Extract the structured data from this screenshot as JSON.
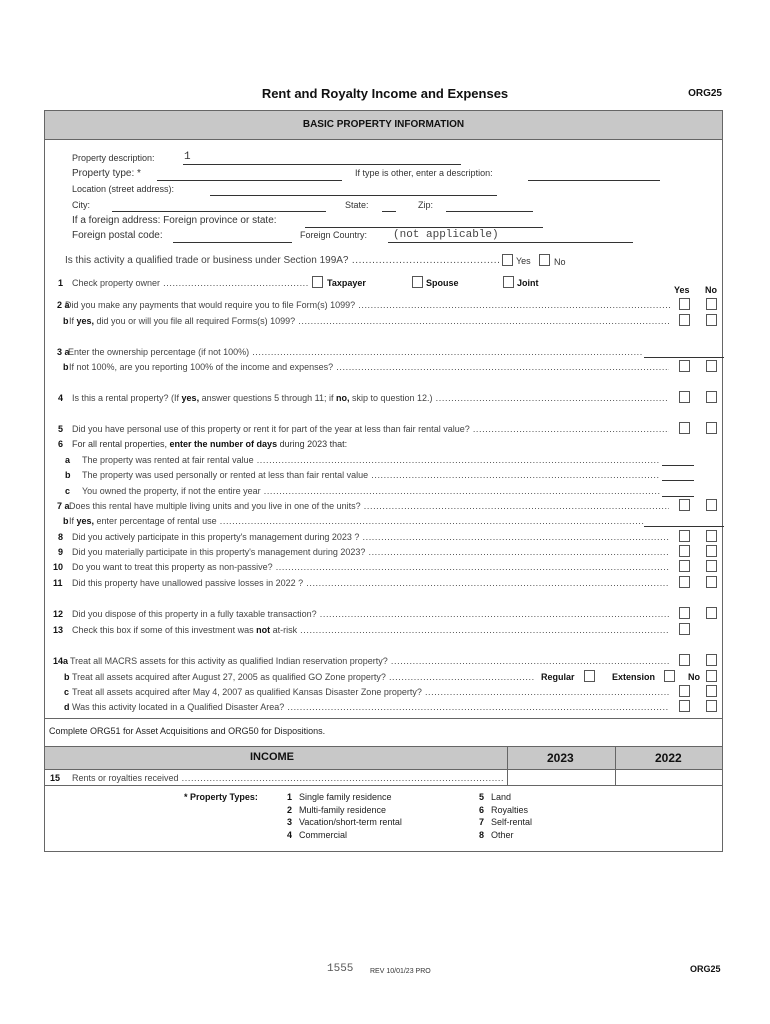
{
  "header": {
    "title": "Rent and Royalty Income and Expenses",
    "form_code": "ORG25"
  },
  "basic_section": {
    "title": "BASIC PROPERTY INFORMATION",
    "fields": {
      "property_description_label": "Property description:",
      "property_description_value": "1",
      "property_type_label": "Property type: *",
      "property_type_value": "",
      "other_description_label": "If type is other, enter a description:",
      "other_description_value": "",
      "location_label": "Location (street address):",
      "location_value": "",
      "city_label": "City:",
      "city_value": "",
      "state_label": "State:",
      "state_value": "",
      "zip_label": "Zip:",
      "zip_value": "",
      "foreign_province_label": "If a foreign address:  Foreign province or state:",
      "foreign_province_value": "",
      "foreign_postal_label": "Foreign postal code:",
      "foreign_postal_value": "",
      "foreign_country_label": "Foreign Country:",
      "foreign_country_value": "(not applicable)"
    },
    "q199a": {
      "text": "Is this activity a qualified trade or business under Section 199A?",
      "yes_label": "Yes",
      "no_label": "No"
    },
    "q1": {
      "num": "1",
      "text": "Check property owner",
      "options": [
        "Taxpayer",
        "Spouse",
        "Joint"
      ]
    },
    "yes_no_header": {
      "yes": "Yes",
      "no": "No"
    },
    "questions": [
      {
        "num": "2 a",
        "text_pre": "Did you make any payments that would require you to file Form(s) 1099?",
        "bold": "",
        "text_post": ""
      },
      {
        "num": "b",
        "text_pre": "If ",
        "bold": "yes,",
        "text_post": " did you or will you file all required Forms(s) 1099?"
      },
      {
        "num": "3 a",
        "text_pre": "Enter the ownership percentage (if not 100%)",
        "bold": "",
        "text_post": ""
      },
      {
        "num": "b",
        "text_pre": "If not 100%, are you reporting 100% of the income and expenses?",
        "bold": "",
        "text_post": ""
      },
      {
        "num": "4",
        "text_pre": "Is this a rental property? (If ",
        "bold": "yes,",
        "text_post": " answer questions 5 through 11; if ",
        "bold2": "no,",
        "text_post2": " skip to question 12.)"
      },
      {
        "num": "5",
        "text_pre": "Did you have personal use of this property or rent it for part of the year at less than fair rental value?",
        "bold": "",
        "text_post": ""
      },
      {
        "num": "6",
        "text_pre": "For all rental properties, ",
        "bold": "enter the number of days",
        "text_post": " during 2023 that:"
      },
      {
        "num": "a",
        "text_pre": "The property was rented at fair rental value",
        "bold": "",
        "text_post": ""
      },
      {
        "num": "b",
        "text_pre": "The property was used personally or rented at less than fair rental value",
        "bold": "",
        "text_post": ""
      },
      {
        "num": "c",
        "text_pre": "You owned the property, if not the entire year",
        "bold": "",
        "text_post": ""
      },
      {
        "num": "7 a",
        "text_pre": "Does this rental have multiple living units and you live in one of the units?",
        "bold": "",
        "text_post": ""
      },
      {
        "num": "b",
        "text_pre": "If ",
        "bold": "yes,",
        "text_post": " enter percentage of rental use"
      },
      {
        "num": "8",
        "text_pre": "Did you actively participate in this property's management during 2023 ?",
        "bold": "",
        "text_post": ""
      },
      {
        "num": "9",
        "text_pre": "Did you materially participate in this property's management during 2023?",
        "bold": "",
        "text_post": ""
      },
      {
        "num": "10",
        "text_pre": "Do you want to treat this property as non-passive?",
        "bold": "",
        "text_post": ""
      },
      {
        "num": "11",
        "text_pre": "Did this property have unallowed passive losses in 2022 ?",
        "bold": "",
        "text_post": ""
      },
      {
        "num": "12",
        "text_pre": "Did you dispose of this property in a fully taxable transaction?",
        "bold": "",
        "text_post": ""
      },
      {
        "num": "13",
        "text_pre": "Check this box if some of this investment was ",
        "bold": "not",
        "text_post": " at-risk"
      },
      {
        "num": "14a",
        "text_pre": "Treat all MACRS assets for this activity as qualified Indian reservation property?",
        "bold": "",
        "text_post": ""
      },
      {
        "num": "b",
        "text_pre": "Treat all assets acquired after August 27, 2005 as qualified GO Zone property?",
        "bold": "",
        "text_post": ""
      },
      {
        "num": "c",
        "text_pre": "Treat all assets acquired after May 4, 2007 as qualified Kansas Disaster Zone property?",
        "bold": "",
        "text_post": ""
      },
      {
        "num": "d",
        "text_pre": "Was this activity located in a Qualified Disaster Area?",
        "bold": "",
        "text_post": ""
      }
    ],
    "q14b_options": {
      "regular": "Regular",
      "extension": "Extension",
      "no": "No"
    },
    "note": "Complete ORG51 for Asset Acquisitions and ORG50 for Dispositions."
  },
  "income_section": {
    "title": "INCOME",
    "col_2023": "2023",
    "col_2022": "2022",
    "rows": [
      {
        "num": "15",
        "label": "Rents or royalties received",
        "value_2023": "",
        "value_2022": ""
      }
    ]
  },
  "property_types": {
    "label": "* Property Types:",
    "items": [
      {
        "num": "1",
        "label": "Single family residence"
      },
      {
        "num": "2",
        "label": "Multi-family residence"
      },
      {
        "num": "3",
        "label": "Vacation/short-term rental"
      },
      {
        "num": "4",
        "label": "Commercial"
      },
      {
        "num": "5",
        "label": "Land"
      },
      {
        "num": "6",
        "label": "Royalties"
      },
      {
        "num": "7",
        "label": "Self-rental"
      },
      {
        "num": "8",
        "label": "Other"
      }
    ]
  },
  "footer": {
    "page_number": "1555",
    "revision": "REV 10/01/23 PRO",
    "form_code": "ORG25"
  }
}
